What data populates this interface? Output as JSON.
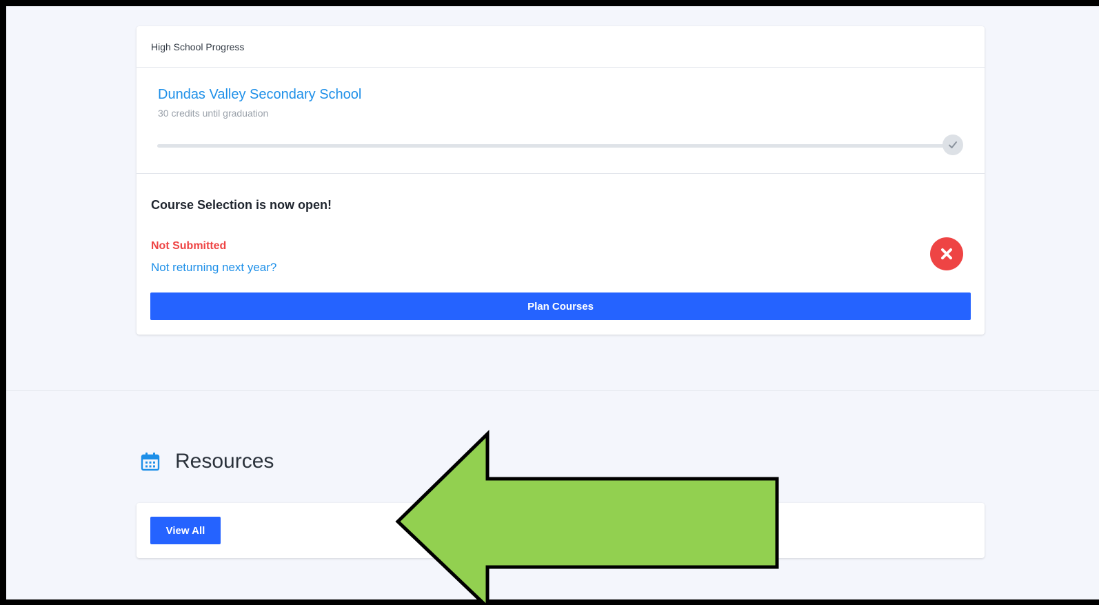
{
  "progress_card": {
    "header": "High School Progress",
    "school_name": "Dundas Valley Secondary School",
    "credits_text": "30 credits until graduation",
    "progress_fraction": 0
  },
  "course_selection": {
    "title": "Course Selection is now open!",
    "status": "Not Submitted",
    "not_returning_link": "Not returning next year?",
    "status_icon": "close-circle-icon",
    "plan_button_label": "Plan Courses"
  },
  "resources": {
    "title": "Resources",
    "icon": "calendar-icon",
    "view_all_label": "View All"
  },
  "annotation": {
    "icon": "left-arrow-annotation",
    "color": "#92d050"
  },
  "colors": {
    "accent": "#2563ff",
    "link": "#1d8fe8",
    "error": "#ee4444",
    "background": "#f4f6fc"
  }
}
